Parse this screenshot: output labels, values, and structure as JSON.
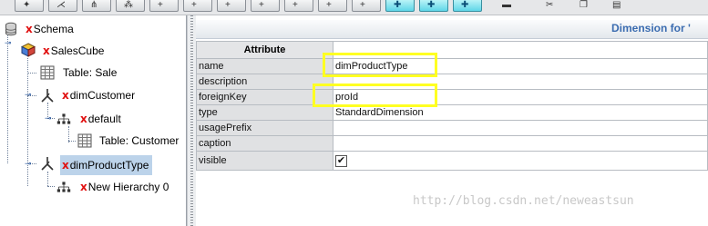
{
  "toolbar": {
    "buttons": [
      {
        "icon": "add-cube-icon",
        "glyph": "✦",
        "highlighted": false
      },
      {
        "icon": "add-dimension-icon",
        "glyph": "⋌",
        "highlighted": false
      },
      {
        "icon": "add-hierarchy-icon",
        "glyph": "⋔",
        "highlighted": false
      },
      {
        "icon": "add-level-icon",
        "glyph": "⁂",
        "highlighted": false
      },
      {
        "icon": "add-measure-icon",
        "glyph": "+",
        "highlighted": false
      },
      {
        "icon": "add-calculated-member-icon",
        "glyph": "+",
        "highlighted": false
      },
      {
        "icon": "add-virtual-cube-icon",
        "glyph": "+",
        "highlighted": false
      },
      {
        "icon": "add-virtual-dimension-icon",
        "glyph": "+",
        "highlighted": false
      },
      {
        "icon": "add-virtual-measure-icon",
        "glyph": "+",
        "highlighted": false
      },
      {
        "icon": "add-role-icon",
        "glyph": "+",
        "highlighted": false
      },
      {
        "icon": "add-schema-grant-icon",
        "glyph": "✚",
        "highlighted": true
      },
      {
        "icon": "add-cube-grant-icon",
        "glyph": "✚",
        "highlighted": true
      },
      {
        "icon": "add-hierarchy-grant-icon",
        "glyph": "✚",
        "highlighted": true
      },
      {
        "icon": "edit-mode-icon",
        "glyph": "▬",
        "highlighted": false
      },
      {
        "icon": "cut-icon",
        "glyph": "✂",
        "highlighted": false
      },
      {
        "icon": "copy-icon",
        "glyph": "❐",
        "highlighted": false
      },
      {
        "icon": "paste-icon",
        "glyph": "▤",
        "highlighted": false
      }
    ]
  },
  "tree": {
    "schema": {
      "prefix": "x",
      "label": "Schema",
      "icon": "database-icon"
    },
    "cube": {
      "prefix": "x",
      "label": "SalesCube",
      "icon": "cube-icon"
    },
    "cube_table": {
      "label": "Table: Sale",
      "icon": "table-icon"
    },
    "dim_customer": {
      "prefix": "x",
      "label": "dimCustomer",
      "icon": "dimension-icon"
    },
    "hier_default": {
      "prefix": "x",
      "label": "default",
      "icon": "hierarchy-icon"
    },
    "customer_table": {
      "label": "Table: Customer",
      "icon": "table-icon"
    },
    "dim_product_type": {
      "prefix": "x",
      "label": "dimProductType",
      "icon": "dimension-icon",
      "selected": true
    },
    "new_hierarchy": {
      "prefix": "x",
      "label": "New Hierarchy 0",
      "icon": "hierarchy-icon"
    }
  },
  "panel": {
    "title": "Dimension for '",
    "header": "Attribute",
    "rows": [
      {
        "key": "name",
        "value": "dimProductType",
        "highlighted": true
      },
      {
        "key": "description",
        "value": ""
      },
      {
        "key": "foreignKey",
        "value": "proId",
        "highlighted": true
      },
      {
        "key": "type",
        "value": "StandardDimension"
      },
      {
        "key": "usagePrefix",
        "value": ""
      },
      {
        "key": "caption",
        "value": ""
      },
      {
        "key": "visible",
        "value": "✔",
        "checkbox": true
      }
    ]
  },
  "watermark": "http://blog.csdn.net/neweastsun",
  "colors": {
    "highlight_box": "#ffff22",
    "prefix_red": "#e01010",
    "selection": "#bcd3ea",
    "title_text": "#3b6cb0"
  }
}
